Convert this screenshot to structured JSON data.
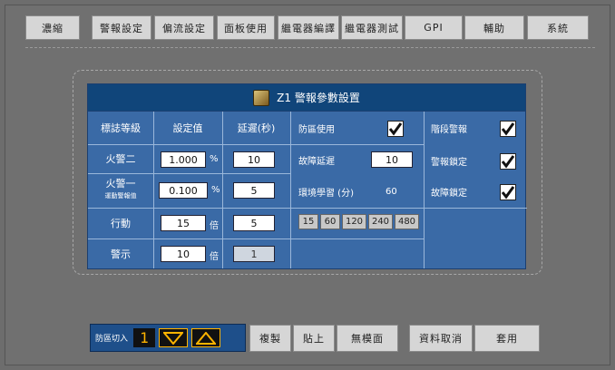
{
  "tabs": [
    "濃縮",
    "警報設定",
    "偏流設定",
    "面板使用",
    "繼電器編譯",
    "繼電器測試",
    "GPI",
    "輔助",
    "系統"
  ],
  "panel": {
    "title": "Z1 警報參數設置",
    "headers": {
      "level": "標誌等級",
      "setting": "設定值",
      "delay": "延遲(秒)"
    },
    "rows": [
      {
        "label": "火警二",
        "value": "1.000",
        "unit": "%",
        "delay": "10"
      },
      {
        "label": "火警一",
        "sublabel": "運動警報值",
        "value": "0.100",
        "unit": "%",
        "delay": "5"
      },
      {
        "label": "行動",
        "value": "15",
        "unit": "倍",
        "delay": "5"
      },
      {
        "label": "警示",
        "value": "10",
        "unit": "倍",
        "delay": "1"
      }
    ],
    "middle": {
      "zone_use": "防區使用",
      "fault_delay": "故障延遲",
      "fault_delay_value": "10",
      "env_learn": "環境學習 (分)",
      "env_learn_value": "60",
      "time_options": [
        "15",
        "60",
        "120",
        "240",
        "480"
      ]
    },
    "right": {
      "stage_alarm": "階段警報",
      "alarm_latch": "警報鎖定",
      "fault_latch": "故障鎖定"
    }
  },
  "stepper": {
    "label": "防區切入",
    "value": "1"
  },
  "buttons": {
    "copy": "複製",
    "paste": "貼上",
    "blank": "無模面",
    "cancel": "資料取消",
    "apply": "套用"
  }
}
